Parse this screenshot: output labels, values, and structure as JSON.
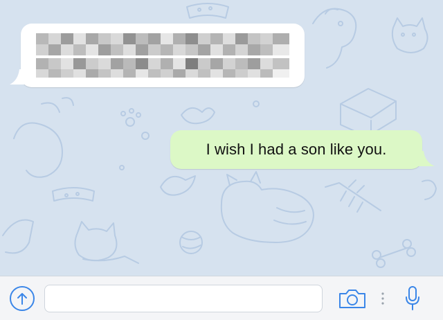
{
  "messages": {
    "incoming": {
      "text_redacted": true
    },
    "outgoing": {
      "text": "I wish I had a son like you."
    }
  },
  "input_bar": {
    "message_field_value": "",
    "icons": [
      "upload-arrow-icon",
      "camera-icon",
      "more-dots-icon",
      "microphone-icon"
    ]
  },
  "colors": {
    "wallpaper": "#d6e2ef",
    "incoming_bubble": "#ffffff",
    "outgoing_bubble": "#dcf8c6",
    "accent": "#3a86e8"
  }
}
